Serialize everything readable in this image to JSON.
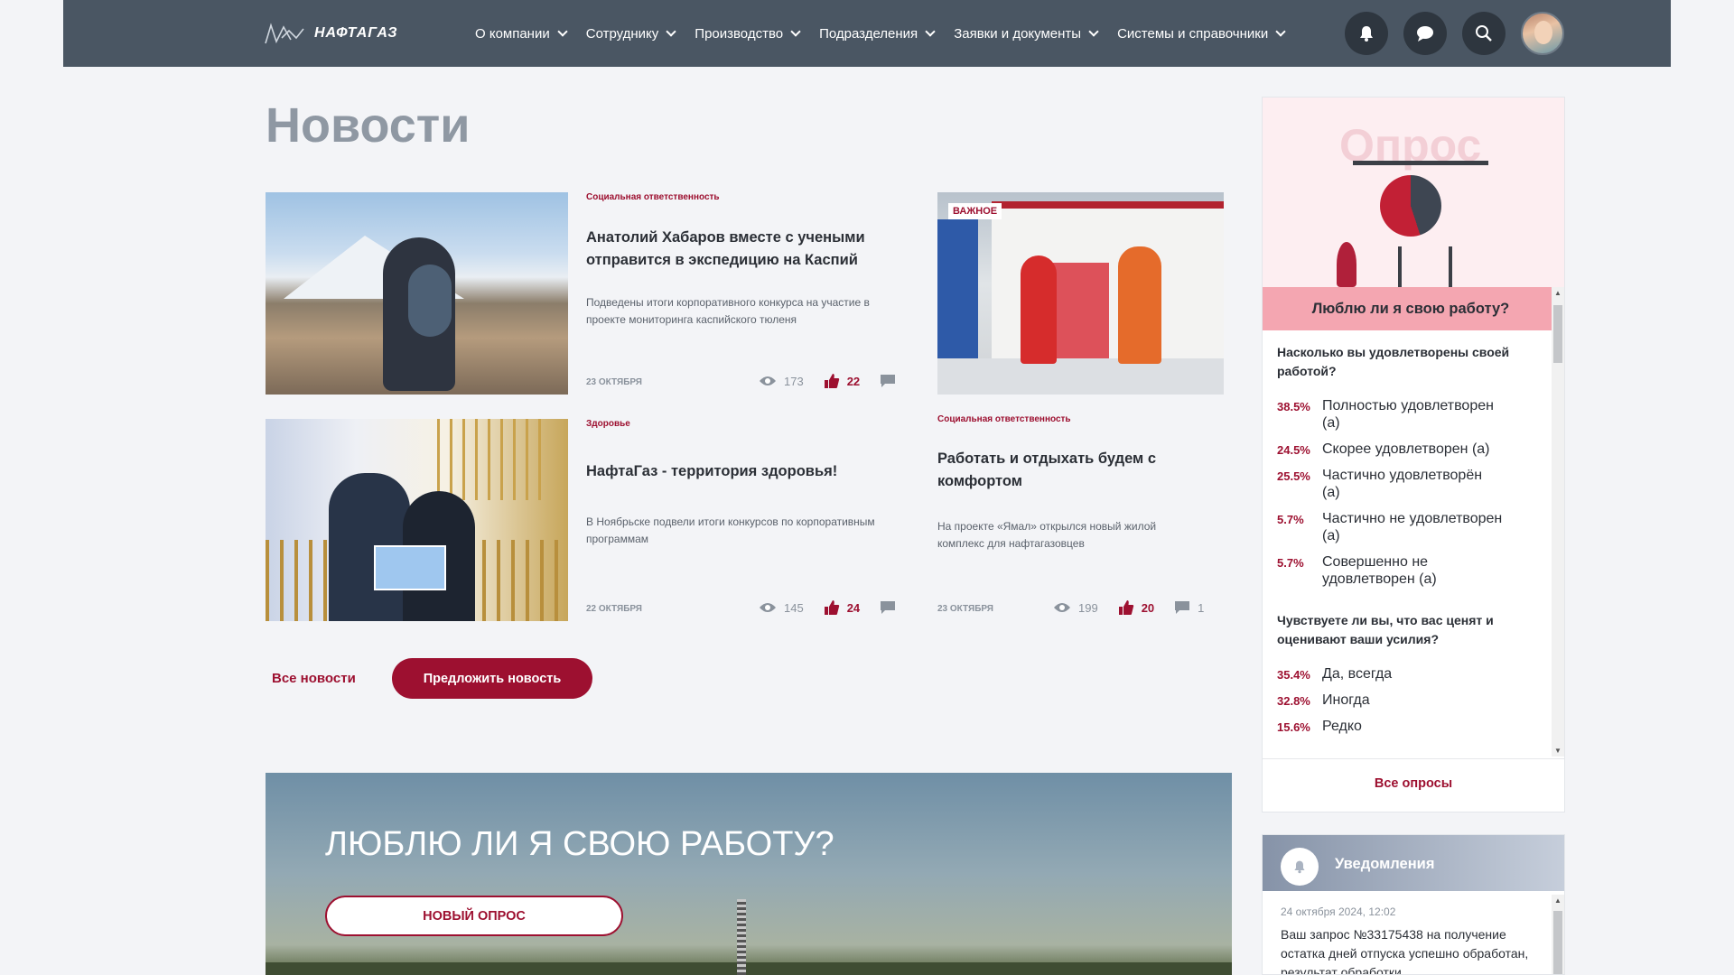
{
  "header": {
    "logo_text": "НАФТАГАЗ",
    "nav": [
      {
        "label": "О компании"
      },
      {
        "label": "Сотруднику"
      },
      {
        "label": "Производство"
      },
      {
        "label": "Подразделения"
      },
      {
        "label": "Заявки и документы"
      },
      {
        "label": "Системы и справочники"
      }
    ],
    "icons": [
      "bell-icon",
      "chat-icon",
      "search-icon",
      "avatar"
    ]
  },
  "page": {
    "title": "Новости"
  },
  "news": [
    {
      "category": "Социальная ответственность",
      "title": "Анатолий Хабаров вместе с учеными отправится в экспедицию на Каспий",
      "description": "Подведены итоги корпоративного конкурса на участие в проекте мониторинга каспийского тюленя",
      "date": "23 октября",
      "views": "173",
      "likes": "22",
      "comments": ""
    },
    {
      "badge": "ВАЖНОЕ",
      "category": "Социальная ответственность",
      "title": "Работать и отдыхать будем с комфортом",
      "description": "На проекте «Ямал» открылся новый жилой комплекс для нафтагазовцев",
      "date": "23 октября",
      "views": "199",
      "likes": "20",
      "comments": "1"
    },
    {
      "category": "Здоровье",
      "title": "НафтаГаз - территория здоровья!",
      "description": "В Ноябрьске подвели итоги конкурсов по корпоративным программам",
      "date": "22 октября",
      "views": "145",
      "likes": "24",
      "comments": ""
    }
  ],
  "actions": {
    "all_news": "Все новости",
    "suggest": "Предложить новость"
  },
  "hero": {
    "title": "ЛЮБЛЮ ЛИ Я СВОЮ РАБОТУ?",
    "button": "НОВЫЙ ОПРОС"
  },
  "poll": {
    "heading_image_word": "Опрос",
    "title": "Люблю ли я свою работу?",
    "questions": [
      {
        "text": "Насколько вы удовлетворены своей работой?",
        "options": [
          {
            "pct": "38.5%",
            "label": "Полностью удовлетворен (а)"
          },
          {
            "pct": "24.5%",
            "label": "Скорее удовлетворен (а)"
          },
          {
            "pct": "25.5%",
            "label": "Частично удовлетворён (а)"
          },
          {
            "pct": "5.7%",
            "label": "Частично не удовлетворен (а)"
          },
          {
            "pct": "5.7%",
            "label": "Совершенно не удовлетворен (а)"
          }
        ]
      },
      {
        "text": "Чувствуете ли вы, что вас ценят и оценивают ваши усилия?",
        "options": [
          {
            "pct": "35.4%",
            "label": "Да, всегда"
          },
          {
            "pct": "32.8%",
            "label": "Иногда"
          },
          {
            "pct": "15.6%",
            "label": "Редко"
          }
        ]
      }
    ],
    "all_polls": "Все опросы"
  },
  "notifications": {
    "title": "Уведомления",
    "items": [
      {
        "date": "24 октября 2024, 12:02",
        "text": "Ваш запрос №33175438 на получение остатка дней отпуска успешно обработан, результат обработки"
      }
    ]
  },
  "colors": {
    "accent": "#9d1030",
    "topbar": "#4a5663",
    "poll_header": "#f4a6b1"
  }
}
